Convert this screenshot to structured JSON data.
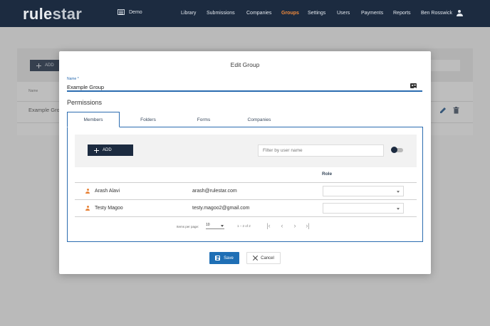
{
  "app": {
    "logo_part1": "rule",
    "logo_part2": "star",
    "org_name": "Demo",
    "nav": [
      {
        "label": "Library"
      },
      {
        "label": "Submissions"
      },
      {
        "label": "Companies"
      },
      {
        "label": "Groups",
        "active": true
      },
      {
        "label": "Settings"
      },
      {
        "label": "Users"
      },
      {
        "label": "Payments"
      },
      {
        "label": "Reports"
      }
    ],
    "user_name": "Ben Rosswick",
    "accent_color": "#f08a3c",
    "header_color": "#1c2b40"
  },
  "background_page": {
    "add_label": "ADD",
    "column_name": "Name",
    "row_name": "Example Group"
  },
  "modal": {
    "title": "Edit Group",
    "name_label": "Name *",
    "name_value": "Example Group",
    "permissions_title": "Permissions",
    "tabs": [
      {
        "label": "Members",
        "active": true
      },
      {
        "label": "Folders"
      },
      {
        "label": "Forms"
      },
      {
        "label": "Companies"
      }
    ],
    "members": {
      "add_label": "ADD",
      "filter_placeholder": "Filter by user name",
      "role_header": "Role",
      "rows": [
        {
          "name": "Arash Alavi",
          "email": "arash@rulestar.com",
          "role": ""
        },
        {
          "name": "Testy Magoo",
          "email": "testy.magoo2@gmail.com",
          "role": ""
        }
      ],
      "pager": {
        "items_per_page_label": "Items per page:",
        "page_size": "10",
        "range": "1 – 2 of 2"
      }
    },
    "save_label": "Save",
    "cancel_label": "Cancel",
    "primary_color": "#1f6fb5"
  }
}
